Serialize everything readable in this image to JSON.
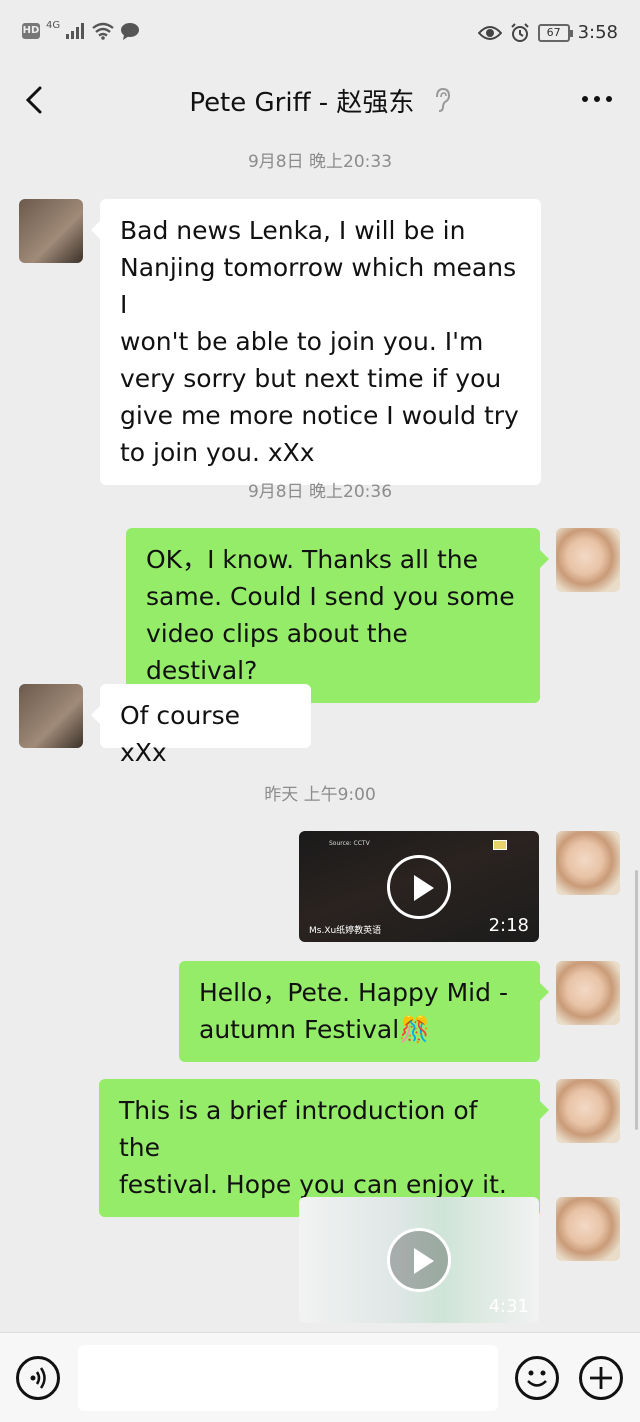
{
  "status_bar": {
    "hd": "HD",
    "network": "4G",
    "battery": "67",
    "time": "3:58"
  },
  "header": {
    "title": "Pete Griff - 赵强东",
    "back_icon": "chevron-left-icon",
    "ear_icon": "ear-icon",
    "more_icon": "more-dots-icon"
  },
  "messages": [
    {
      "type": "timestamp",
      "text": "9月8日 晚上20:33"
    },
    {
      "type": "text",
      "from": "pete",
      "lines": [
        "Bad news Lenka, I will be in",
        "Nanjing tomorrow which means I",
        "won't be able to join you. I'm",
        "very sorry but next time if you",
        "give me more notice I would try",
        "to join you. xXx"
      ]
    },
    {
      "type": "timestamp",
      "text": "9月8日 晚上20:36"
    },
    {
      "type": "text",
      "from": "me",
      "lines": [
        "OK，I know. Thanks all the",
        "same. Could I send you some",
        "video clips about the destival?"
      ]
    },
    {
      "type": "text",
      "from": "pete",
      "lines": [
        "Of course xXx"
      ]
    },
    {
      "type": "timestamp",
      "text": "昨天 上午9:00"
    },
    {
      "type": "video",
      "from": "me",
      "duration": "2:18",
      "source": "Ms.Xu纸婷教英语",
      "tag": "Source: CCTV"
    },
    {
      "type": "text",
      "from": "me",
      "lines": [
        "Hello，Pete. Happy Mid -",
        "autumn Festival🎊"
      ]
    },
    {
      "type": "text",
      "from": "me",
      "lines": [
        "This is a brief introduction of the",
        "festival. Hope you can enjoy it."
      ]
    },
    {
      "type": "video",
      "from": "me",
      "duration": "4:31"
    }
  ],
  "input_bar": {
    "voice_icon": "voice-icon",
    "emoji_icon": "emoji-icon",
    "plus_icon": "plus-icon",
    "placeholder": ""
  },
  "colors": {
    "background": "#ededed",
    "outgoing_bubble": "#95ec69",
    "incoming_bubble": "#ffffff",
    "timestamp": "#8c8c8c"
  }
}
